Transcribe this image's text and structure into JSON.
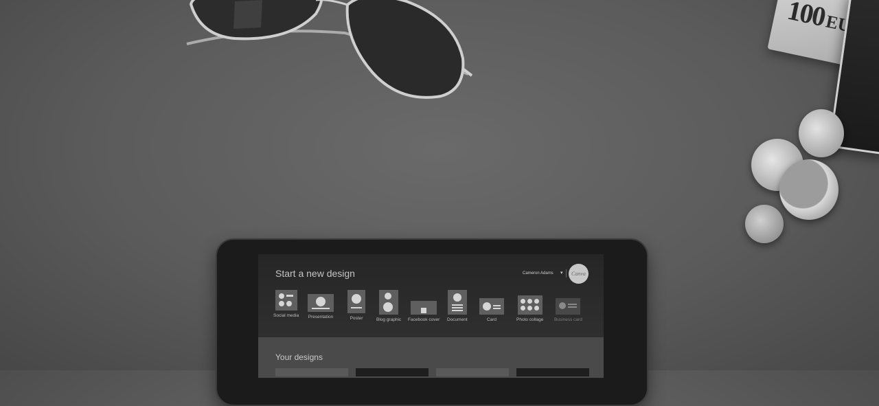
{
  "scene": {
    "objects": [
      "sunglasses-icon",
      "banknote",
      "wallet",
      "coin",
      "tablet"
    ],
    "banknote": {
      "amount": "100",
      "currency_text": "EURO"
    }
  },
  "canva": {
    "header": {
      "title": "Start a new design",
      "user_name": "Cameron Adams",
      "logo_text": "Canva"
    },
    "design_types": [
      {
        "label": "Social media",
        "icon": "social-media-icon"
      },
      {
        "label": "Presentation",
        "icon": "presentation-icon"
      },
      {
        "label": "Poster",
        "icon": "poster-icon"
      },
      {
        "label": "Blog graphic",
        "icon": "blog-graphic-icon"
      },
      {
        "label": "Facebook cover",
        "icon": "facebook-cover-icon"
      },
      {
        "label": "Document",
        "icon": "document-icon"
      },
      {
        "label": "Card",
        "icon": "card-icon"
      },
      {
        "label": "Photo collage",
        "icon": "photo-collage-icon"
      },
      {
        "label": "Business card",
        "icon": "business-card-icon"
      }
    ],
    "your_designs": {
      "title": "Your designs"
    }
  }
}
